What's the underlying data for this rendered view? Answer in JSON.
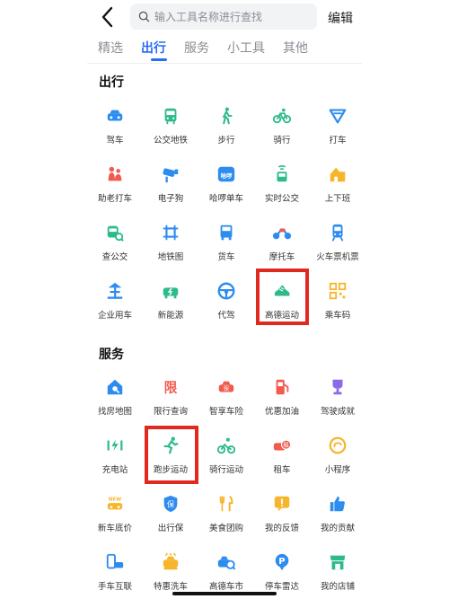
{
  "search": {
    "placeholder": "输入工具名称进行查找"
  },
  "header": {
    "edit_label": "编辑"
  },
  "tabs": [
    {
      "label": "精选"
    },
    {
      "label": "出行"
    },
    {
      "label": "服务"
    },
    {
      "label": "小工具"
    },
    {
      "label": "其他"
    }
  ],
  "travel": {
    "title": "出行",
    "items": [
      {
        "label": "驾车",
        "icon": "car-icon"
      },
      {
        "label": "公交地铁",
        "icon": "bus-icon"
      },
      {
        "label": "步行",
        "icon": "walk-icon"
      },
      {
        "label": "骑行",
        "icon": "bike-icon"
      },
      {
        "label": "打车",
        "icon": "taxi-icon"
      },
      {
        "label": "助老打车",
        "icon": "elder-taxi-icon"
      },
      {
        "label": "电子狗",
        "icon": "camera-icon"
      },
      {
        "label": "哈啰单车",
        "icon": "hellobike-icon",
        "badge": "哈啰"
      },
      {
        "label": "实时公交",
        "icon": "realtime-bus-icon"
      },
      {
        "label": "上下班",
        "icon": "commute-icon"
      },
      {
        "label": "查公交",
        "icon": "bus-query-icon"
      },
      {
        "label": "地铁图",
        "icon": "subway-map-icon"
      },
      {
        "label": "货车",
        "icon": "truck-icon"
      },
      {
        "label": "摩托车",
        "icon": "motorcycle-icon"
      },
      {
        "label": "火车票机票",
        "icon": "train-icon"
      },
      {
        "label": "企业用车",
        "icon": "enterprise-car-icon"
      },
      {
        "label": "新能源",
        "icon": "ev-car-icon"
      },
      {
        "label": "代驾",
        "icon": "steering-wheel-icon"
      },
      {
        "label": "高德运动",
        "icon": "sports-shoe-icon"
      },
      {
        "label": "乘车码",
        "icon": "qr-code-icon"
      }
    ]
  },
  "services": {
    "title": "服务",
    "items": [
      {
        "label": "找房地图",
        "icon": "house-search-icon"
      },
      {
        "label": "限行查询",
        "icon": "restriction-icon",
        "badge": "限"
      },
      {
        "label": "智享车险",
        "icon": "car-insurance-icon",
        "badge": "保"
      },
      {
        "label": "优惠加油",
        "icon": "fuel-icon"
      },
      {
        "label": "驾驶成就",
        "icon": "trophy-icon"
      },
      {
        "label": "充电站",
        "icon": "charging-icon"
      },
      {
        "label": "跑步运动",
        "icon": "run-icon"
      },
      {
        "label": "骑行运动",
        "icon": "cycling-icon"
      },
      {
        "label": "租车",
        "icon": "car-rental-icon",
        "badge": "租"
      },
      {
        "label": "小程序",
        "icon": "mini-program-icon"
      },
      {
        "label": "新车底价",
        "icon": "new-car-icon",
        "badge": "NEW"
      },
      {
        "label": "出行保",
        "icon": "travel-insurance-icon",
        "badge": "保"
      },
      {
        "label": "美食团购",
        "icon": "food-icon"
      },
      {
        "label": "我的反馈",
        "icon": "feedback-icon"
      },
      {
        "label": "我的贡献",
        "icon": "thumbs-up-icon"
      },
      {
        "label": "手车互联",
        "icon": "phone-car-icon"
      },
      {
        "label": "特惠洗车",
        "icon": "car-wash-icon"
      },
      {
        "label": "高德车市",
        "icon": "car-market-icon"
      },
      {
        "label": "停车雷达",
        "icon": "parking-icon",
        "badge": "P"
      },
      {
        "label": "我的店铺",
        "icon": "shop-icon"
      }
    ]
  },
  "colors": {
    "accent": "#2a6cf6",
    "highlight": "#e02a20",
    "blue": "#2d8cf0",
    "green": "#2dbb8a",
    "orange": "#f7b52c",
    "red": "#f25a4e",
    "purple": "#8b6be6"
  }
}
